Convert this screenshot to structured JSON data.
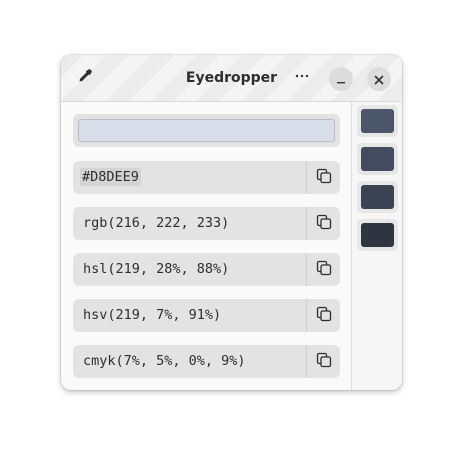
{
  "window": {
    "title": "Eyedropper"
  },
  "header": {
    "picker_icon": "eyedropper-icon",
    "menu_icon": "ellipsis-icon",
    "minimize_icon": "minimize-icon",
    "close_icon": "close-icon"
  },
  "current_color": "#D8DEE9",
  "formats": [
    {
      "value": "#D8DEE9",
      "copy_icon": "copy-icon"
    },
    {
      "value": "rgb(216, 222, 233)",
      "copy_icon": "copy-icon"
    },
    {
      "value": "hsl(219, 28%, 88%)",
      "copy_icon": "copy-icon"
    },
    {
      "value": "hsv(219, 7%, 91%)",
      "copy_icon": "copy-icon"
    },
    {
      "value": "cmyk(7%, 5%, 0%, 9%)",
      "copy_icon": "copy-icon"
    }
  ],
  "history": [
    {
      "color": "#4C566A"
    },
    {
      "color": "#434C5E"
    },
    {
      "color": "#3B4252"
    },
    {
      "color": "#2E3440"
    }
  ],
  "colors": {
    "accent_bg": "#e3e3e3",
    "text": "#2e2e2e"
  }
}
